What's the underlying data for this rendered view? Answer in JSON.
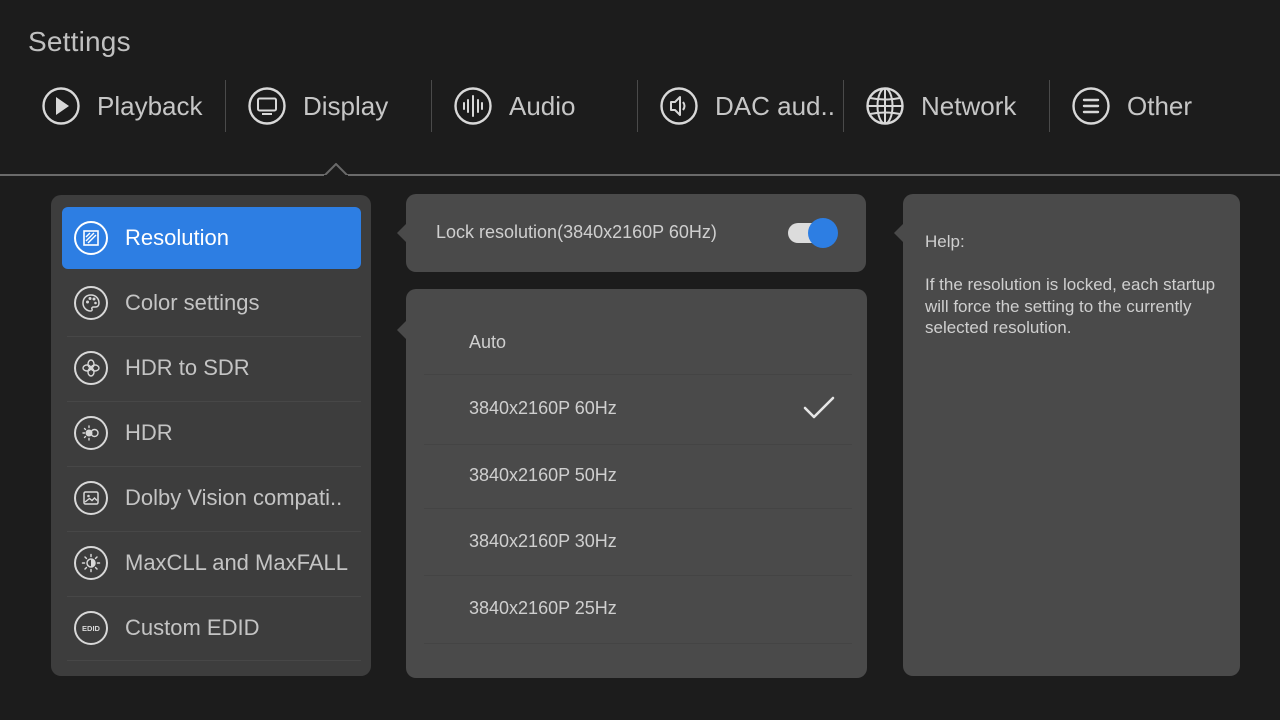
{
  "page_title": "Settings",
  "tabs": [
    {
      "label": "Playback",
      "icon": "play-icon"
    },
    {
      "label": "Display",
      "icon": "monitor-icon",
      "selected": true
    },
    {
      "label": "Audio",
      "icon": "audio-wave-icon"
    },
    {
      "label": "DAC aud..",
      "icon": "speaker-icon"
    },
    {
      "label": "Network",
      "icon": "globe-icon"
    },
    {
      "label": "Other",
      "icon": "menu-icon"
    }
  ],
  "categories": [
    {
      "label": "Resolution",
      "icon": "resolution-icon",
      "selected": true
    },
    {
      "label": "Color settings",
      "icon": "palette-icon"
    },
    {
      "label": "HDR to SDR",
      "icon": "aperture-icon"
    },
    {
      "label": "HDR",
      "icon": "hdr-sun-icon"
    },
    {
      "label": "Dolby Vision compati..",
      "icon": "image-icon"
    },
    {
      "label": "MaxCLL and MaxFALL",
      "icon": "brightness-icon"
    },
    {
      "label": "Custom EDID",
      "icon": "edid-icon",
      "icon_text": "EDID"
    }
  ],
  "lock": {
    "label": "Lock resolution(3840x2160P  60Hz)",
    "enabled": true
  },
  "resolutions": [
    {
      "label": "Auto",
      "checked": false
    },
    {
      "label": "3840x2160P  60Hz",
      "checked": true
    },
    {
      "label": "3840x2160P  50Hz",
      "checked": false
    },
    {
      "label": "3840x2160P  30Hz",
      "checked": false
    },
    {
      "label": "3840x2160P  25Hz",
      "checked": false
    }
  ],
  "help": {
    "title": "Help:",
    "text": "If the resolution is locked, each startup will force the setting to the currently selected resolution."
  },
  "colors": {
    "accent": "#2d7ee3",
    "background": "#1c1c1c",
    "panel": "#4a4a4a",
    "left_panel": "#3d3d3d"
  }
}
